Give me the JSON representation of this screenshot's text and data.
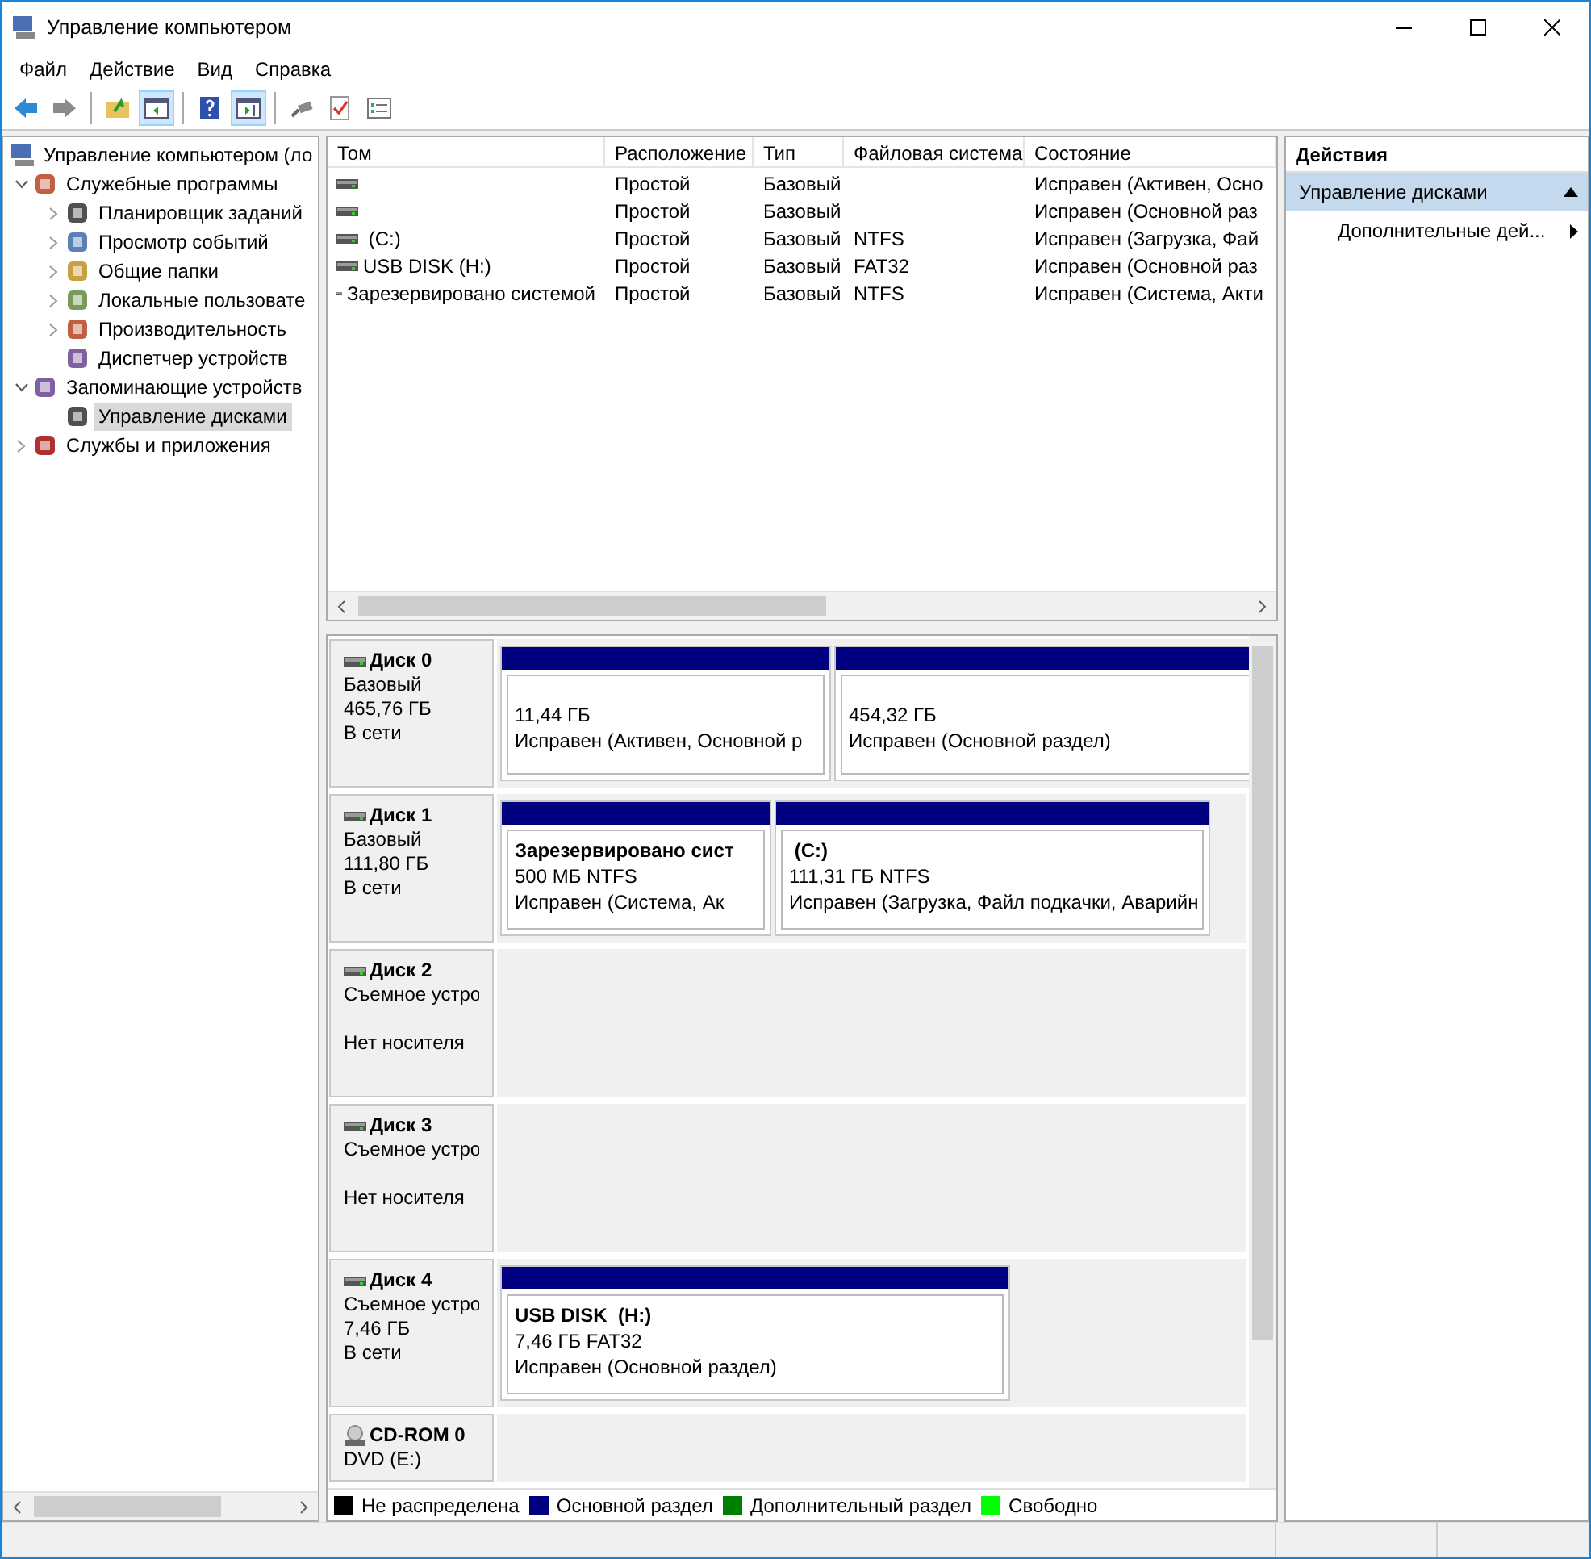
{
  "window": {
    "title": "Управление компьютером"
  },
  "menu": [
    "Файл",
    "Действие",
    "Вид",
    "Справка"
  ],
  "toolbar": [
    {
      "kind": "back",
      "pressed": false
    },
    {
      "kind": "forward",
      "pressed": false
    },
    {
      "kind": "sep"
    },
    {
      "kind": "up",
      "pressed": false
    },
    {
      "kind": "tree",
      "pressed": true
    },
    {
      "kind": "sep"
    },
    {
      "kind": "help",
      "pressed": false
    },
    {
      "kind": "pane",
      "pressed": true
    },
    {
      "kind": "sep"
    },
    {
      "kind": "connect",
      "pressed": false
    },
    {
      "kind": "check",
      "pressed": false
    },
    {
      "kind": "list",
      "pressed": false
    }
  ],
  "tree": [
    {
      "label": "Управление компьютером (ло",
      "selected": false,
      "children": [
        {
          "label": "Служебные программы",
          "selected": false,
          "expanded": true,
          "children": [
            {
              "label": "Планировщик заданий",
              "selected": false,
              "expanded": false
            },
            {
              "label": "Просмотр событий",
              "selected": false,
              "expanded": false
            },
            {
              "label": "Общие папки",
              "selected": false,
              "expanded": false
            },
            {
              "label": "Локальные пользовате",
              "selected": false,
              "expanded": false
            },
            {
              "label": "Производительность",
              "selected": false,
              "expanded": false
            },
            {
              "label": "Диспетчер устройств",
              "selected": false
            }
          ]
        },
        {
          "label": "Запоминающие устройств",
          "selected": false,
          "expanded": true,
          "children": [
            {
              "label": "Управление дисками",
              "selected": true
            }
          ]
        },
        {
          "label": "Службы и приложения",
          "selected": false,
          "expanded": false
        }
      ]
    }
  ],
  "table": {
    "columns": [
      "Том",
      "Расположение",
      "Тип",
      "Файловая система",
      "Состояние"
    ],
    "rows": [
      [
        "",
        "Простой",
        "Базовый",
        "",
        "Исправен (Активен, Осно"
      ],
      [
        "",
        "Простой",
        "Базовый",
        "",
        "Исправен (Основной раз"
      ],
      [
        " (C:)",
        "Простой",
        "Базовый",
        "NTFS",
        "Исправен (Загрузка, Фай"
      ],
      [
        "USB DISK (H:)",
        "Простой",
        "Базовый",
        "FAT32",
        "Исправен (Основной раз"
      ],
      [
        "Зарезервировано системой",
        "Простой",
        "Базовый",
        "NTFS",
        "Исправен (Система, Акти"
      ]
    ]
  },
  "disks": [
    {
      "kind": "disk",
      "name": "Диск 0",
      "type": "Базовый",
      "size": "465,76 ГБ",
      "status": "В сети",
      "partitions": [
        {
          "size": "11,44 ГБ",
          "status": "Исправен (Активен, Основной р"
        },
        {
          "size": "454,32 ГБ",
          "status": "Исправен (Основной раздел)"
        }
      ]
    },
    {
      "kind": "disk",
      "name": "Диск 1",
      "type": "Базовый",
      "size": "111,80 ГБ",
      "status": "В сети",
      "partitions": [
        {
          "title": "Зарезервировано сист",
          "size": "500 МБ NTFS",
          "status": "Исправен (Система, Ак"
        },
        {
          "title": " (C:)",
          "size": "111,31 ГБ NTFS",
          "status": "Исправен (Загрузка, Файл подкачки, Аварийн"
        }
      ]
    },
    {
      "kind": "disk",
      "name": "Диск 2",
      "type": "Съемное устро",
      "status": "Нет носителя"
    },
    {
      "kind": "disk",
      "name": "Диск 3",
      "type": "Съемное устро",
      "status": "Нет носителя"
    },
    {
      "kind": "disk",
      "name": "Диск 4",
      "type": "Съемное устро",
      "size": "7,46 ГБ",
      "status": "В сети",
      "partitions": [
        {
          "title": "USB DISK  (H:)",
          "size": "7,46 ГБ FAT32",
          "status": "Исправен (Основной раздел)"
        }
      ]
    },
    {
      "kind": "cdrom",
      "name": "CD-ROM 0",
      "type": "DVD (E:)"
    }
  ],
  "legend": [
    {
      "label": "Не распределена",
      "color": "#000000"
    },
    {
      "label": "Основной раздел",
      "color": "#000080"
    },
    {
      "label": "Дополнительный раздел",
      "color": "#008000"
    },
    {
      "label": "Свободно",
      "color": "#00ff00"
    }
  ],
  "actions": {
    "title": "Действия",
    "section": {
      "label": "Управление дисками",
      "expanded": true
    },
    "items": [
      "Дополнительные дей..."
    ]
  }
}
